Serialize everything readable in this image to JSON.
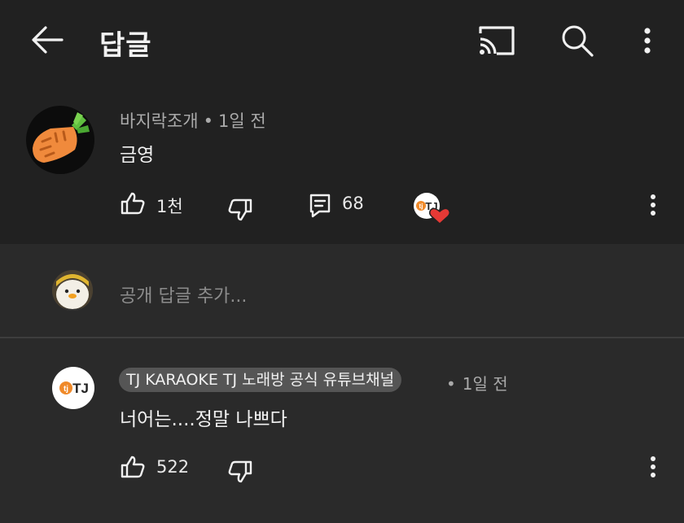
{
  "header": {
    "title": "답글",
    "back_icon": "arrow-left-icon",
    "cast_icon": "cast-icon",
    "search_icon": "search-icon",
    "more_icon": "more-vert-icon"
  },
  "comment": {
    "author": "바지락조개",
    "separator": "•",
    "time": "1일 전",
    "text": "금영",
    "likes": "1천",
    "replies": "68",
    "creator_heart": true
  },
  "reply_input": {
    "placeholder": "공개 답글 추가..."
  },
  "reply": {
    "channel": "TJ KARAOKE TJ 노래방 공식 유튜브채널",
    "separator": "•",
    "time": "1일 전",
    "text": "너어는....정말 나쁘다",
    "likes": "522"
  },
  "colors": {
    "background": "#2a2a2a",
    "highlight_panel": "#212121",
    "text_primary": "#f1f1f1",
    "text_secondary": "#aaaaaa",
    "heart": "#e53935"
  }
}
